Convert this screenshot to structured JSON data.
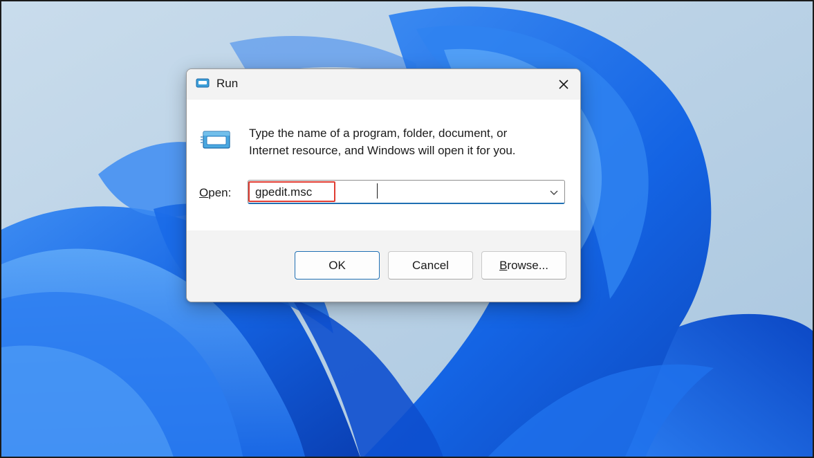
{
  "dialog": {
    "title": "Run",
    "description_line1": "Type the name of a program, folder, document, or",
    "description_line2": "Internet resource, and Windows will open it for you.",
    "open_label_prefix": "",
    "open_label_mnemonic": "O",
    "open_label_rest": "pen:",
    "input_value": "gpedit.msc",
    "icons": {
      "title": "run-icon",
      "main": "run-icon",
      "close": "close-icon",
      "dropdown": "chevron-down-icon"
    }
  },
  "buttons": {
    "ok_label": "OK",
    "cancel_label": "Cancel",
    "browse_mnemonic": "B",
    "browse_rest": "rowse..."
  },
  "colors": {
    "accent": "#1f6fb3",
    "highlight": "#e03c31",
    "wallpaper_blue": "#1565e0",
    "wallpaper_bg": "#b9d2e6"
  }
}
